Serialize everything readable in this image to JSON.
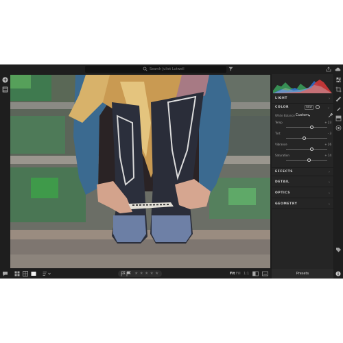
{
  "topbar": {
    "search_placeholder": "Search Juliet Lutwell"
  },
  "panel": {
    "sections": {
      "light": "LIGHT",
      "color": "COLOR",
      "effects": "EFFECTS",
      "detail": "DETAIL",
      "optics": "OPTICS",
      "geometry": "GEOMETRY"
    },
    "bw_label": "B&W",
    "white_balance": {
      "label": "White Balance",
      "value": "Custom"
    },
    "sliders": [
      {
        "name": "Temp",
        "value": "+ 23",
        "position": 0.62
      },
      {
        "name": "Tint",
        "value": "- 3",
        "position": 0.44
      },
      {
        "name": "Vibrance",
        "value": "+ 26",
        "position": 0.62
      },
      {
        "name": "Saturation",
        "value": "+ 14",
        "position": 0.55
      }
    ]
  },
  "bottombar": {
    "rating": {
      "max": 5,
      "value": 0
    },
    "zoom": {
      "fit": "Fit",
      "fill": "Fill",
      "one_to_one": "1:1"
    },
    "presets_label": "Presets"
  },
  "colors": {
    "app_bg": "#1c1c1c",
    "panel_bg": "#252525",
    "accent_swatch_1": "#3a9a5a",
    "accent_swatch_2": "#2f6fd0",
    "accent_swatch_3": "#d2383a"
  },
  "icons": [
    "search-icon",
    "filter-icon",
    "share-icon",
    "cloud-icon",
    "add-icon",
    "library-icon",
    "help-icon",
    "edit-sliders-icon",
    "crop-icon",
    "healing-brush-icon",
    "brush-icon",
    "gradient-icon",
    "radial-icon",
    "tag-icon",
    "info-icon",
    "grid-view-icon",
    "square-grid-icon",
    "single-view-icon",
    "sort-icon",
    "flag-icon",
    "star-icon",
    "compare-icon",
    "export-icon",
    "eyedropper-icon"
  ]
}
